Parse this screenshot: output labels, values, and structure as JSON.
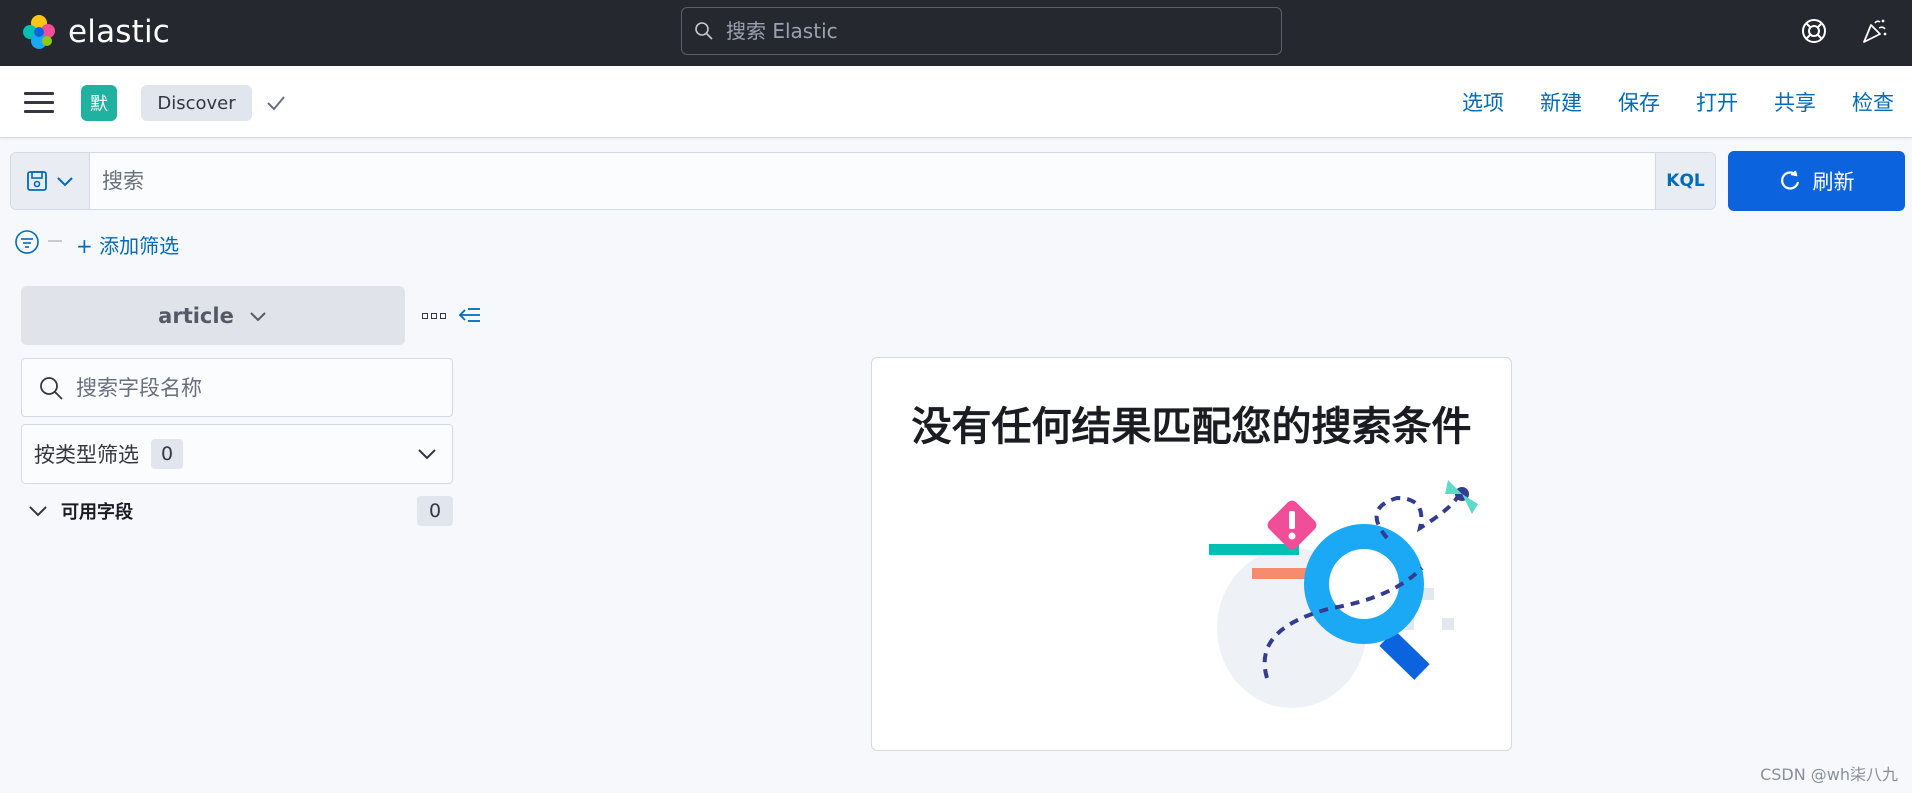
{
  "header": {
    "logo_text": "elastic",
    "search_placeholder": "搜索 Elastic"
  },
  "subheader": {
    "space_initial": "默",
    "breadcrumb": "Discover",
    "links": [
      "选项",
      "新建",
      "保存",
      "打开",
      "共享",
      "检查"
    ]
  },
  "querybar": {
    "placeholder": "搜索",
    "language": "KQL",
    "refresh_label": "刷新"
  },
  "filters": {
    "add_label": "+ 添加筛选"
  },
  "sidebar": {
    "index_pattern": "article",
    "field_search_placeholder": "搜索字段名称",
    "type_filter_label": "按类型筛选",
    "type_filter_count": "0",
    "available_fields_label": "可用字段",
    "available_fields_count": "0"
  },
  "main": {
    "empty_title": "没有任何结果匹配您的搜索条件"
  },
  "watermark": "CSDN @wh柒八九",
  "colors": {
    "header_bg": "#25282f",
    "link": "#006bb8",
    "primary_button": "#0b64dd",
    "space_avatar": "#20b2a0"
  }
}
